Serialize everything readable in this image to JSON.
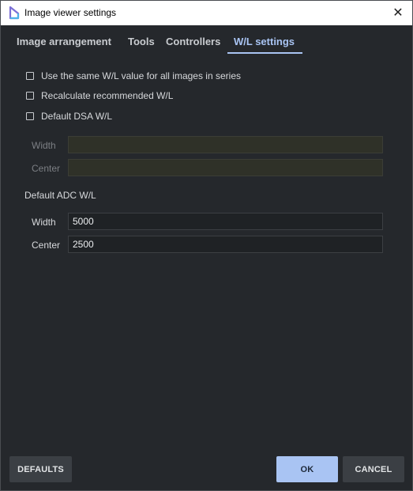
{
  "window": {
    "title": "Image viewer settings",
    "close_glyph": "✕"
  },
  "tabs": [
    {
      "label": "Image arrangement"
    },
    {
      "label": "Tools"
    },
    {
      "label": "Controllers"
    },
    {
      "label": "W/L settings",
      "active": true
    }
  ],
  "options": [
    {
      "label": "Use the same W/L value for all images in series",
      "checked": false
    },
    {
      "label": "Recalculate recommended W/L",
      "checked": false
    },
    {
      "label": "Default DSA W/L",
      "checked": false
    }
  ],
  "dsa": {
    "width_label": "Width",
    "width_value": "",
    "center_label": "Center",
    "center_value": ""
  },
  "adc": {
    "section_label": "Default ADC W/L",
    "width_label": "Width",
    "width_value": "5000",
    "center_label": "Center",
    "center_value": "2500"
  },
  "buttons": {
    "defaults": "DEFAULTS",
    "ok": "OK",
    "cancel": "CANCEL"
  },
  "colors": {
    "accent": "#a9c4f3",
    "background": "#25282c",
    "titlebar": "#ffffff"
  },
  "icons": {
    "app": "app-logo-icon",
    "close": "close-icon"
  }
}
